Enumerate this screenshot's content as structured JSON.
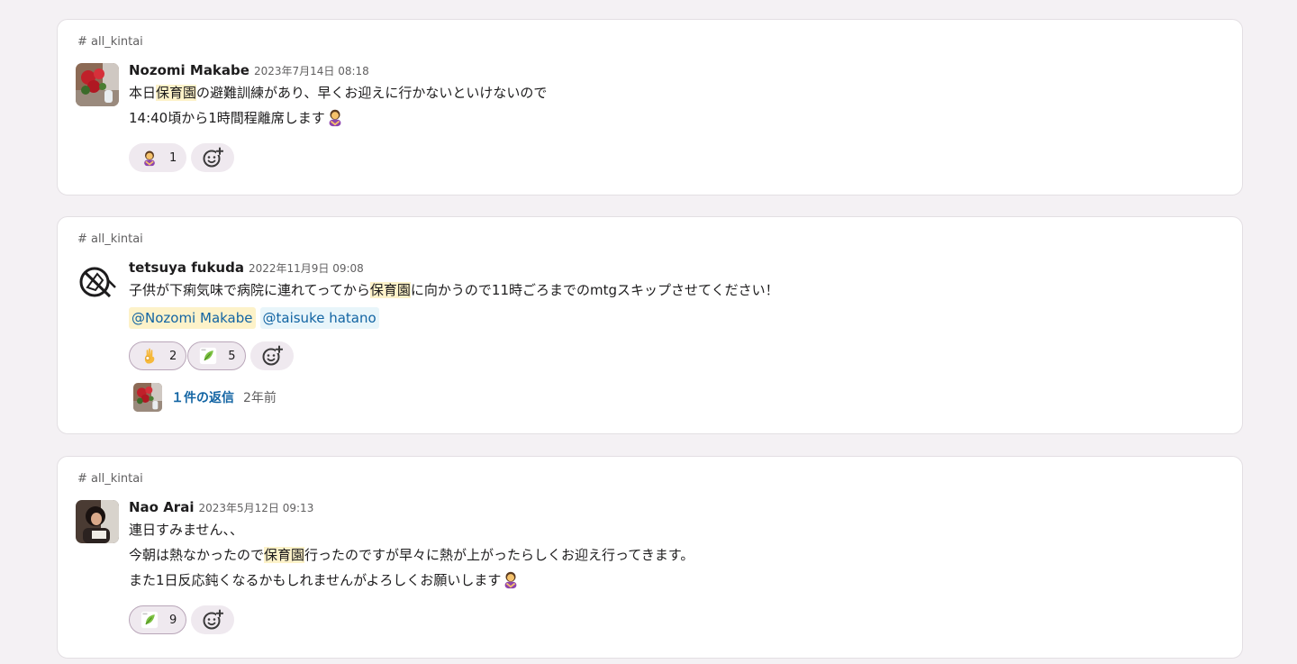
{
  "messages": [
    {
      "channel": "# all_kintai",
      "author": "Nozomi Makabe",
      "time": "2023年7月14日 08:18",
      "line1_a": "本日",
      "line1_hl": "保育園",
      "line1_b": "の避難訓練があり、早くお迎えに行かないといけないので",
      "line2": "14:40頃から1時間程離席します",
      "reactions": [
        {
          "icon": "person-bowing-icon",
          "count": "1"
        }
      ]
    },
    {
      "channel": "# all_kintai",
      "author": "tetsuya fukuda",
      "time": "2022年11月9日 09:08",
      "line1_a": "子供が下痢気味で病院に連れてってから",
      "line1_hl": "保育園",
      "line1_b": "に向かうので11時ごろまでのmtgスキップさせてください！",
      "mentions": [
        "@Nozomi Makabe",
        "@taisuke hatano"
      ],
      "reactions": [
        {
          "icon": "ok-hand-icon",
          "count": "2"
        },
        {
          "icon": "leaf-sticker-icon",
          "count": "5"
        }
      ],
      "thread": {
        "replies": "１件の返信",
        "when": "2年前"
      }
    },
    {
      "channel": "# all_kintai",
      "author": "Nao Arai",
      "time": "2023年5月12日 09:13",
      "line1": "連日すみません、、",
      "line2_a": "今朝は熱なかったので",
      "line2_hl": "保育園",
      "line2_b": "行ったのですが早々に熱が上がったらしくお迎え行ってきます。",
      "line3": "また1日反応鈍くなるかもしれませんがよろしくお願いします",
      "reactions": [
        {
          "icon": "leaf-sticker-icon",
          "count": "9"
        }
      ]
    }
  ],
  "colors": {
    "background": "#f4f1f4",
    "highlight": "#fdf2c9",
    "link": "#1264a3",
    "reaction_border": "#b9a6b9"
  }
}
